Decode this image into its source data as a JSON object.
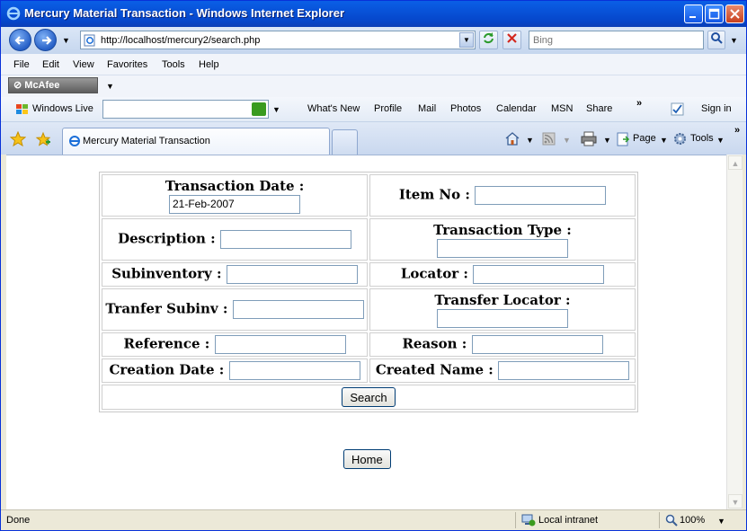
{
  "window": {
    "title": "Mercury Material Transaction - Windows Internet Explorer"
  },
  "address_bar": {
    "url": "http://localhost/mercury2/search.php",
    "search_placeholder": "Bing"
  },
  "menu": [
    "File",
    "Edit",
    "View",
    "Favorites",
    "Tools",
    "Help"
  ],
  "mcafee": {
    "label": "McAfee"
  },
  "live_toolbar": {
    "brand": "Windows Live",
    "links": [
      "What's New",
      "Profile",
      "Mail",
      "Photos",
      "Calendar",
      "MSN",
      "Share"
    ],
    "more": "»",
    "sign_in": "Sign in"
  },
  "tabs": {
    "active_label": "Mercury Material Transaction"
  },
  "command_bar": {
    "page": "Page",
    "tools": "Tools",
    "more": "»"
  },
  "form": {
    "transaction_date": {
      "label": "Transaction Date :",
      "value": "21-Feb-2007"
    },
    "item_no": {
      "label": "Item No :",
      "value": ""
    },
    "description": {
      "label": "Description :",
      "value": ""
    },
    "transaction_type": {
      "label": "Transaction Type :",
      "value": ""
    },
    "subinventory": {
      "label": "Subinventory :",
      "value": ""
    },
    "locator": {
      "label": "Locator :",
      "value": ""
    },
    "transfer_subinv": {
      "label": "Tranfer Subinv :",
      "value": ""
    },
    "transfer_locator": {
      "label": "Transfer Locator :",
      "value": ""
    },
    "reference": {
      "label": "Reference :",
      "value": ""
    },
    "reason": {
      "label": "Reason :",
      "value": ""
    },
    "creation_date": {
      "label": "Creation Date :",
      "value": ""
    },
    "created_name": {
      "label": "Created Name :",
      "value": ""
    },
    "search_button": "Search"
  },
  "home_button": "Home",
  "status_bar": {
    "status": "Done",
    "zone": "Local intranet",
    "zoom": "100%"
  }
}
